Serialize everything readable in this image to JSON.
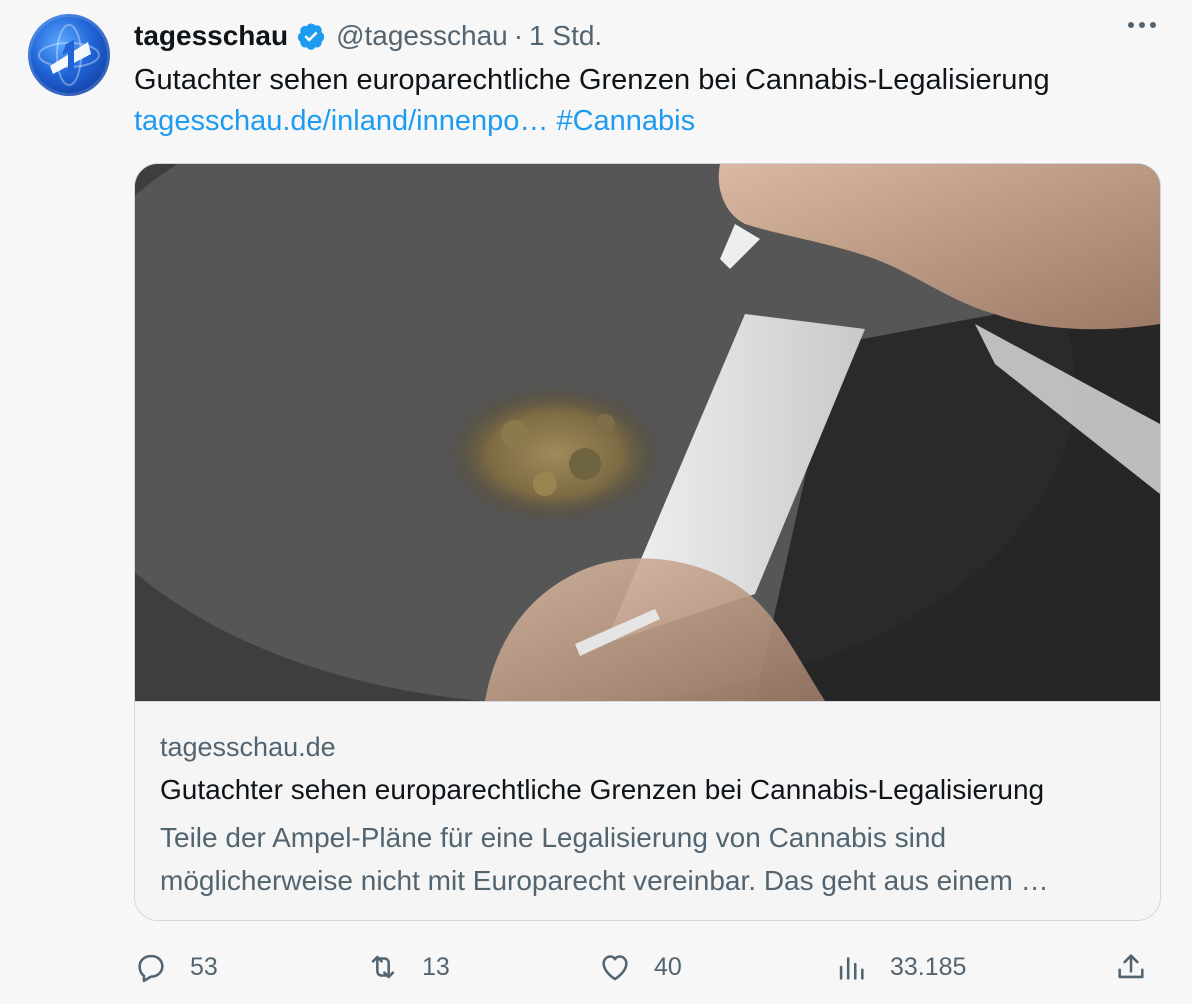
{
  "tweet": {
    "author_name": "tagesschau",
    "handle": "@tagesschau",
    "separator": "·",
    "time": "1 Std.",
    "text": "Gutachter sehen europarechtliche Grenzen bei Cannabis-Legalisierung",
    "link_text": "tagesschau.de/inland/innenpo…",
    "hashtag": "#Cannabis"
  },
  "card": {
    "domain": "tagesschau.de",
    "title": "Gutachter sehen europarechtliche Grenzen bei Cannabis-Legalisierung",
    "description": "Teile der Ampel-Pläne für eine Legalisierung von Cannabis sind möglicherweise nicht mit Europarecht vereinbar. Das geht aus einem …"
  },
  "actions": {
    "replies": "53",
    "retweets": "13",
    "likes": "40",
    "views": "33.185"
  },
  "icons": {
    "avatar": "tagesschau-logo-icon",
    "verified": "verified-badge-icon",
    "more": "more-icon",
    "reply": "reply-icon",
    "retweet": "retweet-icon",
    "like": "heart-icon",
    "views": "views-icon",
    "share": "share-icon"
  },
  "colors": {
    "link": "#1d9bf0",
    "secondary_text": "#536471",
    "primary_text": "#0f1419",
    "verified": "#1d9bf0"
  }
}
